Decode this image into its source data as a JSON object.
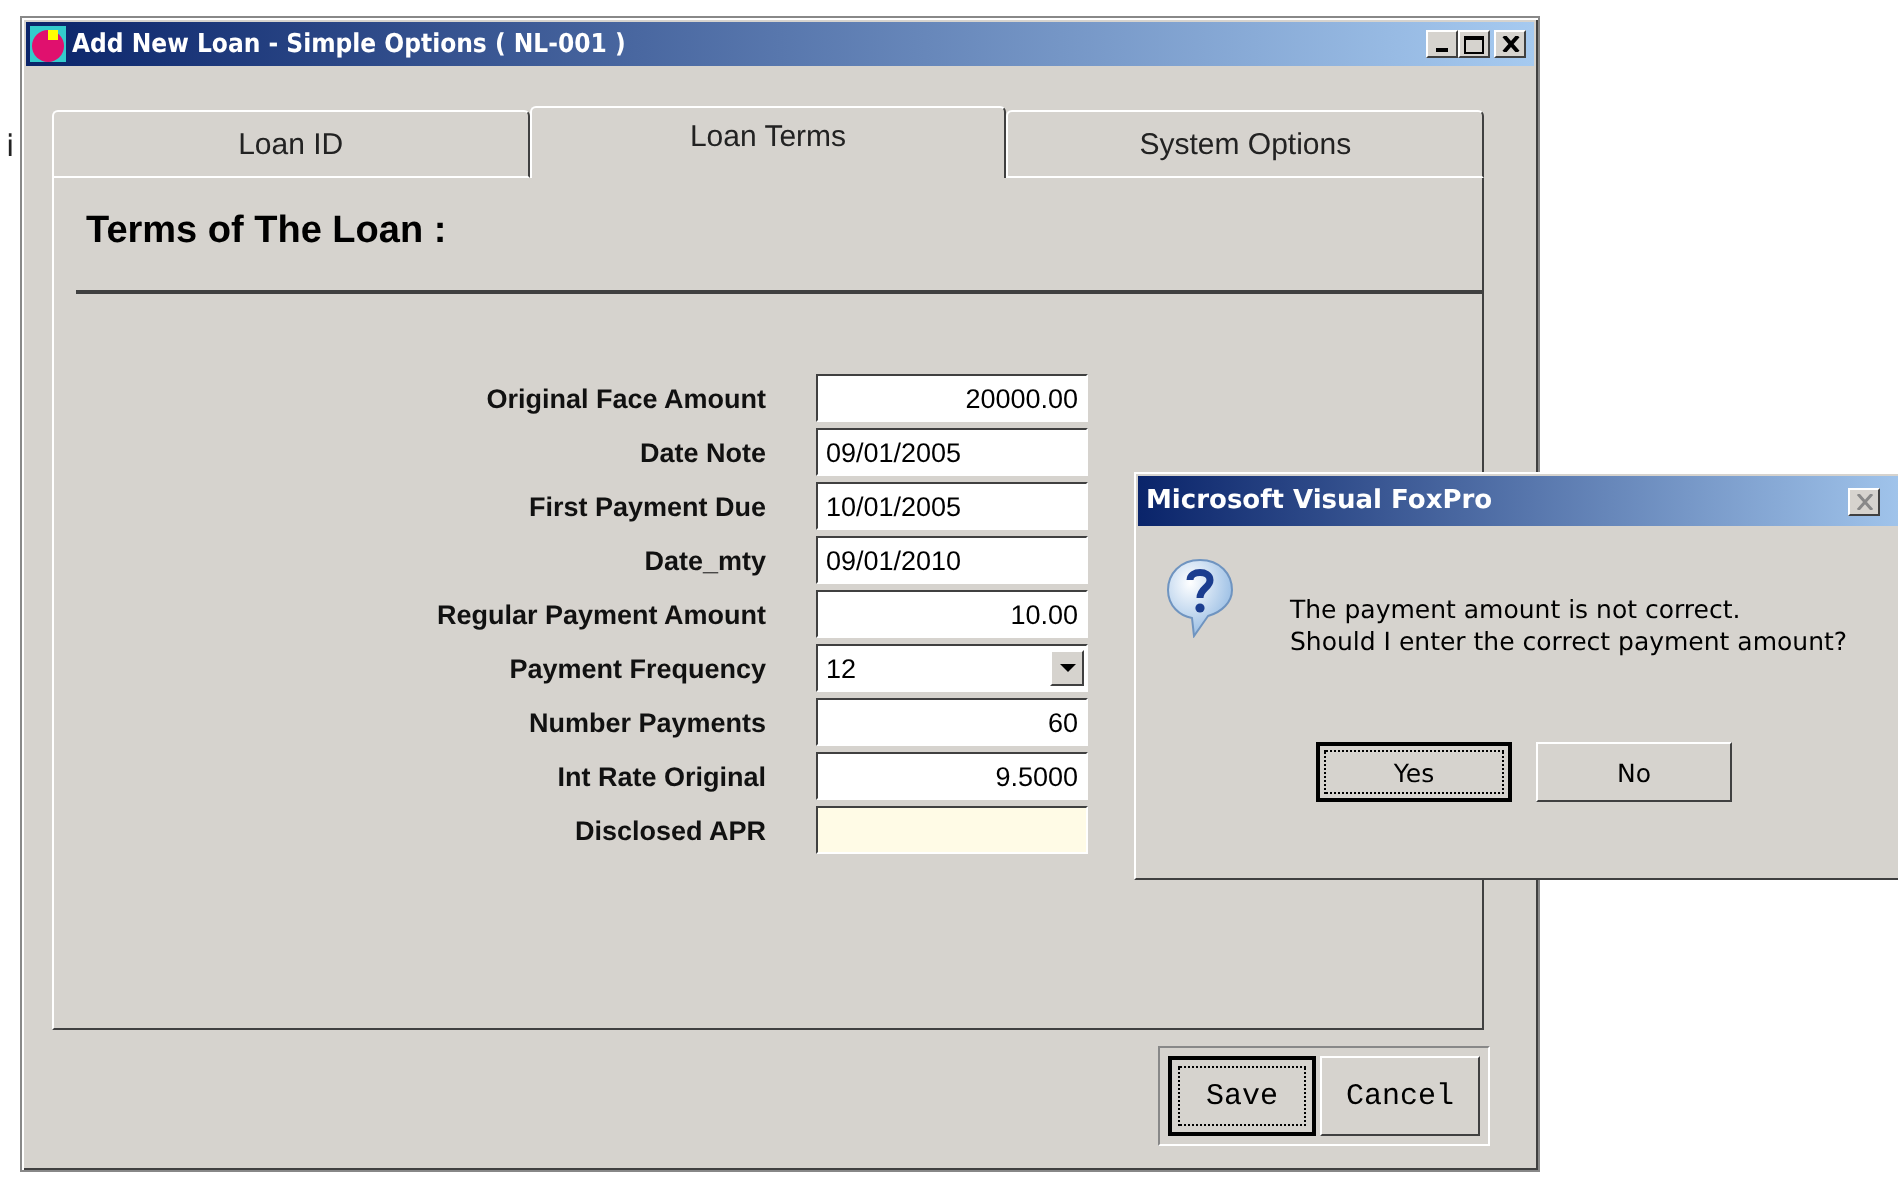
{
  "background": {
    "text": "i"
  },
  "window": {
    "title": "Add New Loan - Simple Options ( NL-001 )"
  },
  "tabs": [
    {
      "label": "Loan ID",
      "selected": false
    },
    {
      "label": "Loan Terms",
      "selected": true
    },
    {
      "label": "System Options",
      "selected": false
    }
  ],
  "section_title": "Terms of The Loan :",
  "fields": [
    {
      "label": "Original Face Amount",
      "value": "20000.00",
      "kind": "number"
    },
    {
      "label": "Date Note",
      "value": "09/01/2005",
      "kind": "text"
    },
    {
      "label": "First Payment Due",
      "value": "10/01/2005",
      "kind": "text"
    },
    {
      "label": "Date_mty",
      "value": "09/01/2010",
      "kind": "text"
    },
    {
      "label": "Regular Payment Amount",
      "value": "10.00",
      "kind": "number"
    },
    {
      "label": "Payment Frequency",
      "value": "12",
      "kind": "dropdown"
    },
    {
      "label": "Number Payments",
      "value": "60",
      "kind": "number"
    },
    {
      "label": "Int Rate Original",
      "value": "9.5000",
      "kind": "number"
    },
    {
      "label": "Disclosed APR",
      "kind": "readonly"
    }
  ],
  "buttons": [
    {
      "label": "Save",
      "focused": true
    },
    {
      "label": "Cancel",
      "focused": false
    }
  ],
  "dialog": {
    "title": "Microsoft Visual FoxPro",
    "message": [
      "The payment amount is not correct.",
      "Should I enter the correct payment amount?"
    ],
    "buttons": [
      {
        "label": "Yes",
        "focused": true
      },
      {
        "label": "No",
        "focused": false
      }
    ]
  }
}
